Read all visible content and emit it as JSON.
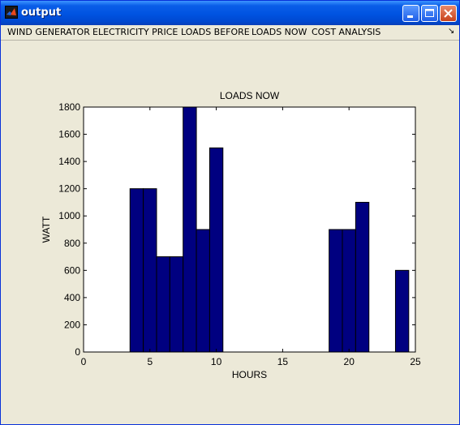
{
  "window": {
    "title": "output",
    "controls": {
      "minimize": "minimize-icon",
      "maximize": "maximize-icon",
      "close": "close-icon"
    }
  },
  "menu": {
    "items": [
      {
        "label": "WIND GENERATOR"
      },
      {
        "label": "ELECTRICITY PRICE"
      },
      {
        "label": "LOADS BEFORE"
      },
      {
        "label": "LOADS NOW"
      },
      {
        "label": "COST ANALYSIS"
      }
    ],
    "overflow_icon": "arrow-icon"
  },
  "colors": {
    "bar_fill": "#000080",
    "window_bg": "#ece9d8",
    "title_bar": "#0053e1"
  },
  "chart_data": {
    "type": "bar",
    "title": "LOADS NOW",
    "xlabel": "HOURS",
    "ylabel": "WATT",
    "xlim": [
      0,
      25
    ],
    "ylim": [
      0,
      1800
    ],
    "xticks": [
      0,
      5,
      10,
      15,
      20,
      25
    ],
    "yticks": [
      0,
      200,
      400,
      600,
      800,
      1000,
      1200,
      1400,
      1600,
      1800
    ],
    "x": [
      1,
      2,
      3,
      4,
      5,
      6,
      7,
      8,
      9,
      10,
      11,
      12,
      13,
      14,
      15,
      16,
      17,
      18,
      19,
      20,
      21,
      22,
      23,
      24
    ],
    "values": [
      0,
      0,
      0,
      1200,
      1200,
      700,
      700,
      1800,
      900,
      1500,
      0,
      0,
      0,
      0,
      0,
      0,
      0,
      0,
      900,
      900,
      1100,
      0,
      0,
      600
    ],
    "grid": false
  }
}
